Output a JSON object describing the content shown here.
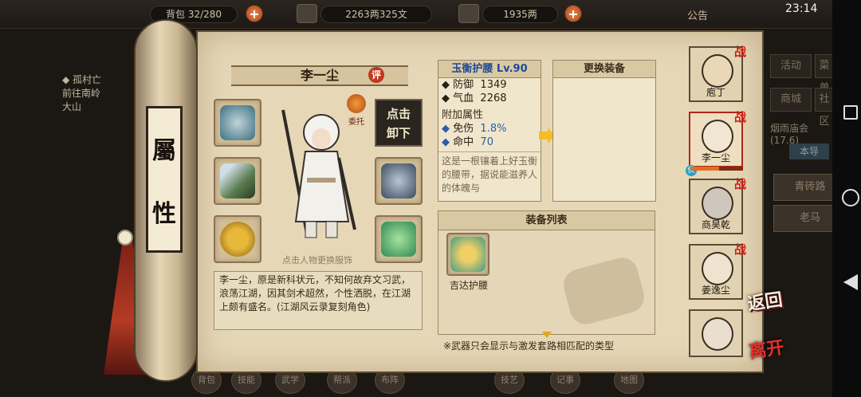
{
  "topbar": {
    "bag_label": "背包",
    "bag_count": "32/280",
    "coins": "2263两325文",
    "gold": "1935两",
    "notice": "公告",
    "clock": "23:14"
  },
  "quest": {
    "title": "◆ 孤村亡",
    "line1": "前往南岭",
    "line2": "大山"
  },
  "scroll_tab": {
    "char1": "屬",
    "char2": "性"
  },
  "character": {
    "name": "李一尘",
    "rate_label": "评",
    "entrust_label": "委托",
    "unequip_line1": "点击",
    "unequip_line2": "卸下",
    "hint": "点击人物更换服饰",
    "bio": "李一尘，原是新科状元，不知何故弃文习武，浪荡江湖，因其剑术超然，个性洒脱，在江湖上颇有盛名。(江湖风云录复刻角色)"
  },
  "equip": {
    "title": "玉衡护腰 Lv.90",
    "stats": [
      {
        "name": "防御",
        "value": "1349"
      },
      {
        "name": "气血",
        "value": "2268"
      }
    ],
    "extra_title": "附加属性",
    "extra": [
      {
        "name": "免伤",
        "value": "1.8%"
      },
      {
        "name": "命中",
        "value": "70"
      }
    ],
    "desc": "这是一根镶着上好玉衡的腰带，据说能滋养人的体魄与"
  },
  "replace": {
    "title": "更换装备"
  },
  "list": {
    "title": "装备列表",
    "items": [
      {
        "name": "吉达护腰"
      }
    ],
    "note": "※武器只会显示与激发套路相匹配的类型"
  },
  "right_menu": [
    "活动",
    "菜单",
    "商城",
    "社区"
  ],
  "side": {
    "event": "烟雨庙会",
    "event_count": "(17.6)",
    "tab": "本导",
    "road": "青砖路",
    "horse": "老马"
  },
  "portraits": [
    {
      "name": "庖丁",
      "battle": "战"
    },
    {
      "name": "李一尘",
      "battle": "战"
    },
    {
      "name": "商昊乾",
      "battle": "战"
    },
    {
      "name": "姜逸尘",
      "battle": "战"
    },
    {
      "name": "",
      "battle": ""
    }
  ],
  "hp_fraction": 0.55,
  "buttons": {
    "back": "返回",
    "leave": "离开"
  },
  "bottom_nav": [
    "背包",
    "技能",
    "武学",
    "帮派",
    "布阵",
    "技艺",
    "记事",
    "地图"
  ],
  "colors": {
    "accent_red": "#c0381e",
    "equip_blue": "#1e4a92",
    "parchment": "#e6d8b7"
  }
}
